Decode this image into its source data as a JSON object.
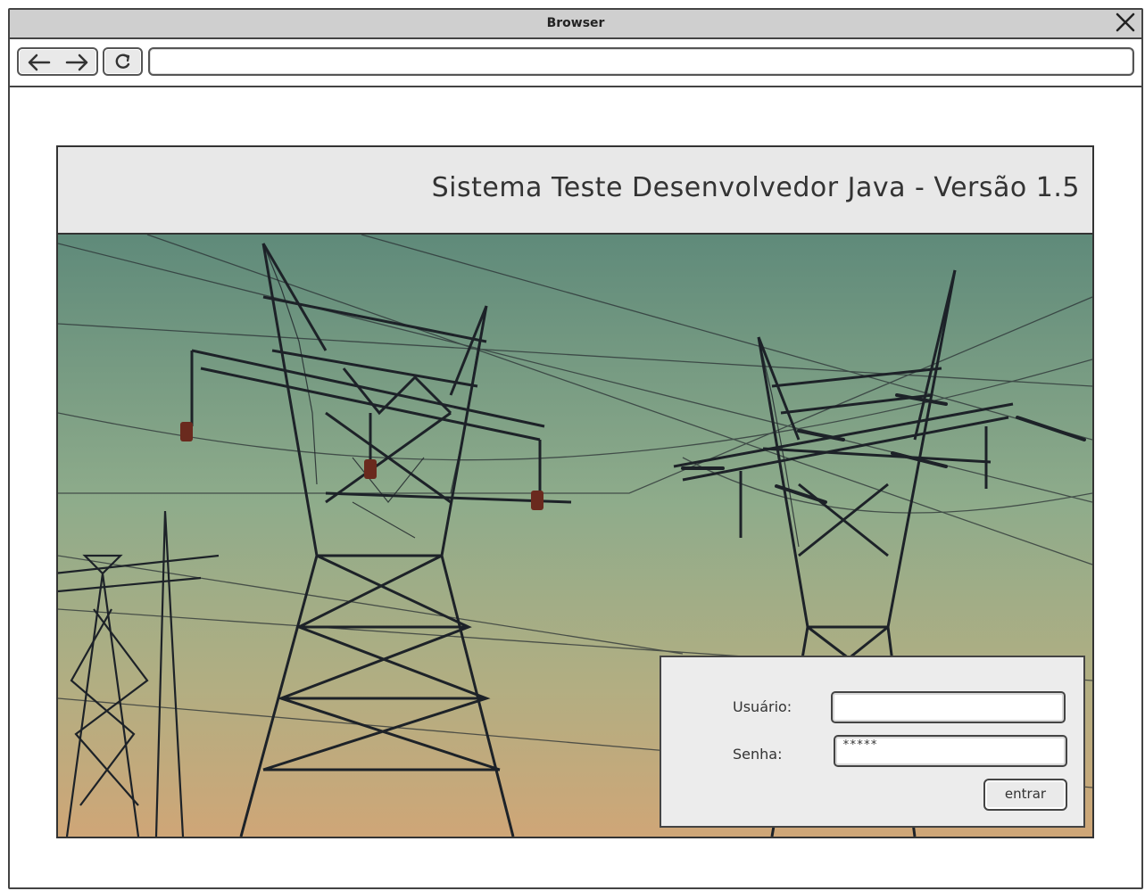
{
  "browser": {
    "title": "Browser",
    "address_value": ""
  },
  "header": {
    "app_title": "Sistema Teste Desenvolvedor Java -  Versão 1.5"
  },
  "login": {
    "user_label": "Usuário:",
    "user_value": "",
    "password_label": "Senha:",
    "password_value": "*****",
    "submit_label": "entrar"
  },
  "colors": {
    "sky_top": "#5f8a7a",
    "sky_mid": "#91ad8a",
    "sky_bottom": "#c7a77a",
    "tower": "#1d2228",
    "chrome_gray": "#cfcfcf",
    "panel_gray": "#ececec"
  }
}
